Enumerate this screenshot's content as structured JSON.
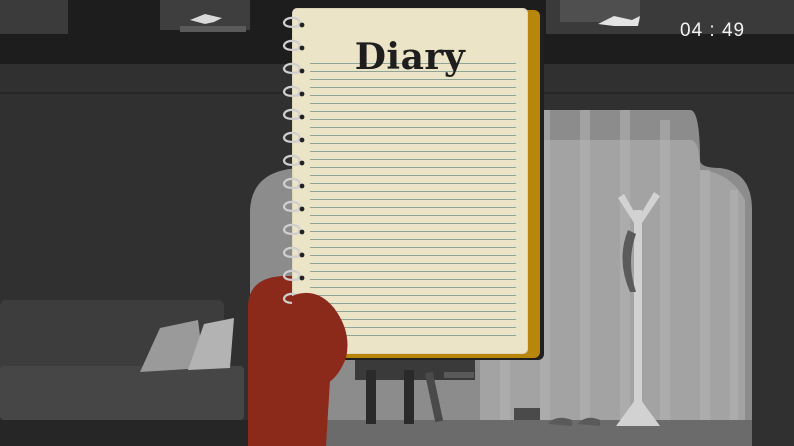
{
  "hud": {
    "timer": "04 : 49"
  },
  "diary": {
    "title": "Diary"
  },
  "colors": {
    "page": "#ece4c7",
    "page_edge": "#b8860b",
    "rule_line": "#6f8f86",
    "hand": "#8b2a1b",
    "background": "#2b2b2b"
  },
  "icons": {
    "binding": "spiral-binding-icon",
    "fish_left": "paper-fish-icon",
    "fish_right": "paper-fish-icon",
    "coat_rack": "coat-rack-icon",
    "sofa": "sofa-icon",
    "chair": "chair-icon",
    "shoes": "shoes-icon"
  }
}
